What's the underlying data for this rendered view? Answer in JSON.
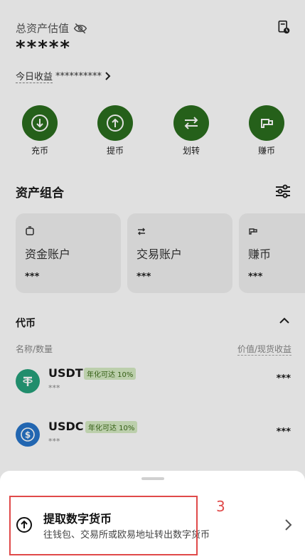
{
  "header": {
    "total_label": "总资产估值",
    "total_value": "*****",
    "today_label": "今日收益",
    "today_value": "**********"
  },
  "actions": [
    {
      "label": "充币",
      "icon": "deposit-icon"
    },
    {
      "label": "提币",
      "icon": "withdraw-icon"
    },
    {
      "label": "划转",
      "icon": "transfer-icon"
    },
    {
      "label": "赚币",
      "icon": "earn-icon"
    }
  ],
  "portfolio": {
    "title": "资产组合",
    "cards": [
      {
        "name": "资金账户",
        "value": "***"
      },
      {
        "name": "交易账户",
        "value": "***"
      },
      {
        "name": "赚币",
        "value": "***"
      }
    ]
  },
  "tokens": {
    "title": "代币",
    "col_left": "名称/数量",
    "col_right": "价值/现货收益",
    "items": [
      {
        "name": "USDT",
        "badge": "年化可达 10%",
        "sub": "***",
        "value": "***",
        "color": "#26a17b"
      },
      {
        "name": "USDC",
        "badge": "年化可达 10%",
        "sub": "***",
        "value": "***",
        "color": "#2775ca"
      }
    ]
  },
  "sheet": {
    "option_title": "提取数字货币",
    "option_sub": "往钱包、交易所或欧易地址转出数字货币"
  },
  "annotation": {
    "number": "3",
    "color": "#e04a4a"
  },
  "colors": {
    "accent_green": "#2b6e1e"
  }
}
